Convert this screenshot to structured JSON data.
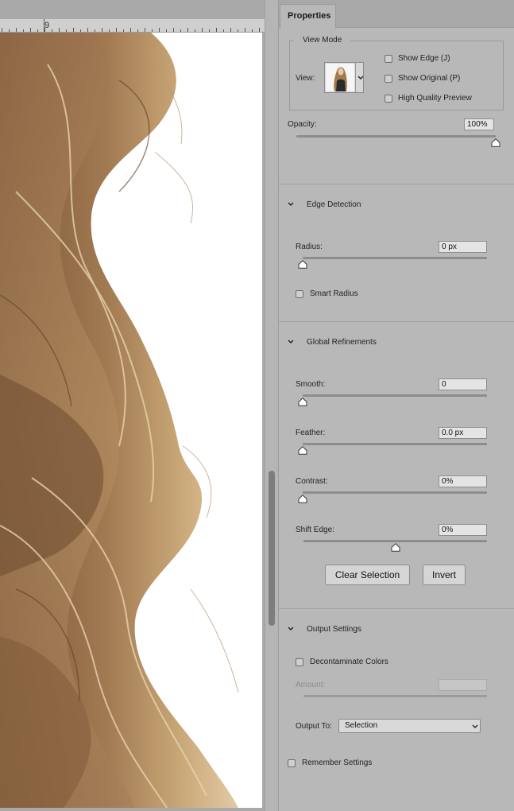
{
  "ruler": {
    "number": "9"
  },
  "panel": {
    "tab": "Properties",
    "view_mode": {
      "legend": "View Mode",
      "view_label": "View:",
      "show_edge": {
        "label": "Show Edge (J)",
        "checked": false
      },
      "show_original": {
        "label": "Show Original (P)",
        "checked": false
      },
      "high_quality_preview": {
        "label": "High Quality Preview",
        "checked": false
      },
      "opacity_label": "Opacity:",
      "opacity_value": "100%",
      "opacity_level": 1.0
    },
    "edge_detection": {
      "title": "Edge Detection",
      "radius_label": "Radius:",
      "radius_value": "0 px",
      "radius_level": 0.0,
      "smart_radius": {
        "label": "Smart Radius",
        "checked": false
      }
    },
    "global_refinements": {
      "title": "Global Refinements",
      "smooth_label": "Smooth:",
      "smooth_value": "0",
      "smooth_level": 0.0,
      "feather_label": "Feather:",
      "feather_value": "0.0 px",
      "feather_level": 0.0,
      "contrast_label": "Contrast:",
      "contrast_value": "0%",
      "contrast_level": 0.0,
      "shift_edge_label": "Shift Edge:",
      "shift_edge_value": "0%",
      "shift_edge_level": 0.5,
      "clear_selection": "Clear Selection",
      "invert": "Invert"
    },
    "output_settings": {
      "title": "Output Settings",
      "decontaminate": {
        "label": "Decontaminate Colors",
        "checked": false
      },
      "amount_label": "Amount:",
      "amount_value": "",
      "output_to_label": "Output To:",
      "output_to_value": "Selection"
    },
    "remember_settings": {
      "label": "Remember Settings",
      "checked": false
    }
  },
  "icons": {
    "chevron": "chevron-down-icon",
    "slider_thumb": "slider-thumb-icon"
  },
  "colors": {
    "panel_bg": "#b8b8b8",
    "field_bg": "#e4e4e4",
    "hair_dark": "#7a5636",
    "hair_light": "#d9bb8d"
  }
}
